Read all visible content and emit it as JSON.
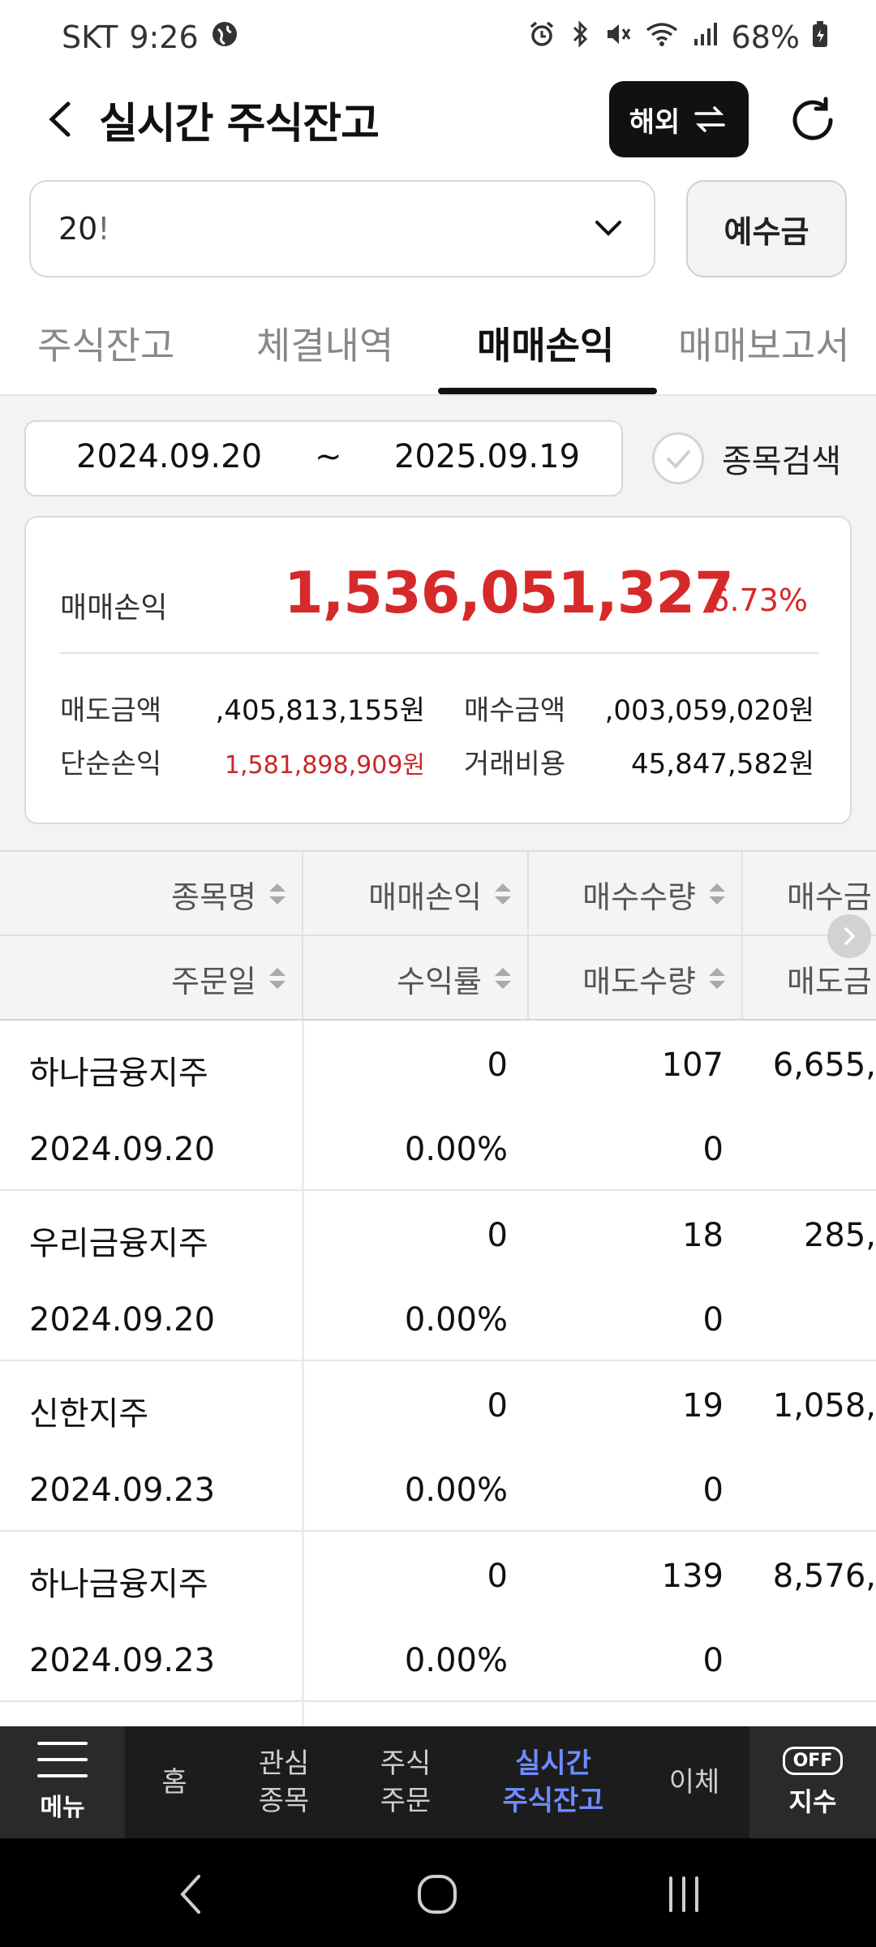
{
  "status_bar": {
    "carrier": "SKT",
    "time": "9:26",
    "battery": "68%"
  },
  "header": {
    "title": "실시간 주식잔고",
    "overseas_label": "해외"
  },
  "account": {
    "number_visible": "20!",
    "deposit_label": "예수금"
  },
  "tabs": [
    {
      "label": "주식잔고",
      "active": false
    },
    {
      "label": "체결내역",
      "active": false
    },
    {
      "label": "매매손익",
      "active": true
    },
    {
      "label": "매매보고서",
      "active": false
    }
  ],
  "filter": {
    "start_date": "2024.09.20",
    "tilde": "~",
    "end_date": "2025.09.19",
    "stock_search_label": "종목검색"
  },
  "summary": {
    "pl_label": "매매손익",
    "pl_value": "1,536,051,327",
    "pl_rate": "6.73%",
    "sell_amount_label": "매도금액",
    "sell_amount": ",405,813,155원",
    "buy_amount_label": "매수금액",
    "buy_amount": ",003,059,020원",
    "simple_pl_label": "단순손익",
    "simple_pl": "1,581,898,909원",
    "fee_label": "거래비용",
    "fee": "45,847,582원"
  },
  "table": {
    "headers_row1": [
      "종목명",
      "매매손익",
      "매수수량",
      "매수금"
    ],
    "headers_row2": [
      "주문일",
      "수익률",
      "매도수량",
      "매도금"
    ],
    "rows": [
      {
        "name": "하나금융지주",
        "date": "2024.09.20",
        "pl": "0",
        "rate": "0.00%",
        "buy_qty": "107",
        "sell_qty": "0",
        "buy_amt": "6,655,"
      },
      {
        "name": "우리금융지주",
        "date": "2024.09.20",
        "pl": "0",
        "rate": "0.00%",
        "buy_qty": "18",
        "sell_qty": "0",
        "buy_amt": "285,"
      },
      {
        "name": "신한지주",
        "date": "2024.09.23",
        "pl": "0",
        "rate": "0.00%",
        "buy_qty": "19",
        "sell_qty": "0",
        "buy_amt": "1,058,"
      },
      {
        "name": "하나금융지주",
        "date": "2024.09.23",
        "pl": "0",
        "rate": "0.00%",
        "buy_qty": "139",
        "sell_qty": "0",
        "buy_amt": "8,576,"
      }
    ]
  },
  "bottom_nav": {
    "menu_label": "메뉴",
    "items": [
      {
        "line1": "홈",
        "line2": "",
        "active": false
      },
      {
        "line1": "관심",
        "line2": "종목",
        "active": false
      },
      {
        "line1": "주식",
        "line2": "주문",
        "active": false
      },
      {
        "line1": "실시간",
        "line2": "주식잔고",
        "active": true
      },
      {
        "line1": "이체",
        "line2": "",
        "active": false
      }
    ],
    "index_badge": "OFF",
    "index_label": "지수"
  },
  "colors": {
    "profit_red": "#d62a2a",
    "nav_active": "#6f8cff",
    "nav_bg": "#1c1c1c"
  }
}
